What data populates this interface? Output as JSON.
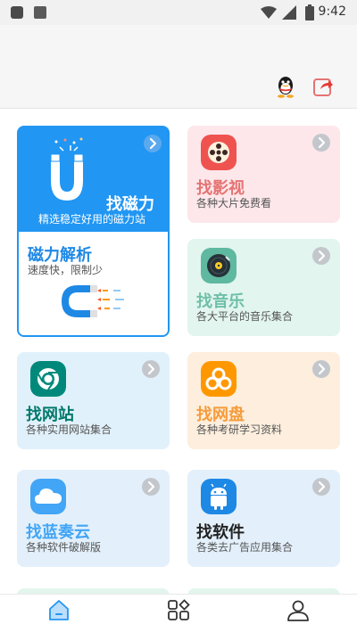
{
  "status_bar": {
    "time": "9:42"
  },
  "magnet_card": {
    "title": "找磁力",
    "subtitle": "精选稳定好用的磁力站",
    "section_title": "磁力解析",
    "section_subtitle": "速度快，限制少"
  },
  "cards": {
    "movies": {
      "title": "找影视",
      "subtitle": "各种大片免费看"
    },
    "music": {
      "title": "找音乐",
      "subtitle": "各大平台的音乐集合"
    },
    "websites": {
      "title": "找网站",
      "subtitle": "各种实用网站集合"
    },
    "netdisk": {
      "title": "找网盘",
      "subtitle": "各种考研学习资料"
    },
    "lanzou": {
      "title": "找蓝奏云",
      "subtitle": "各种软件破解版"
    },
    "software": {
      "title": "找软件",
      "subtitle": "各类去广告应用集合"
    }
  },
  "colors": {
    "primary_blue": "#2196F3",
    "movies_bg": "#FDE7EA",
    "music_bg": "#E2F5EF",
    "websites_bg": "#E1F1FB",
    "netdisk_bg": "#FDEEDD",
    "lanzou_bg": "#E3F0FB",
    "software_bg": "#E3F0FB"
  },
  "icons": [
    "qq-icon",
    "share-icon",
    "magnet-icon",
    "film-reel-icon",
    "vinyl-record-icon",
    "chrome-icon",
    "cloud-flower-icon",
    "cloud-icon",
    "android-icon",
    "home-icon",
    "grid-icon",
    "user-icon"
  ]
}
